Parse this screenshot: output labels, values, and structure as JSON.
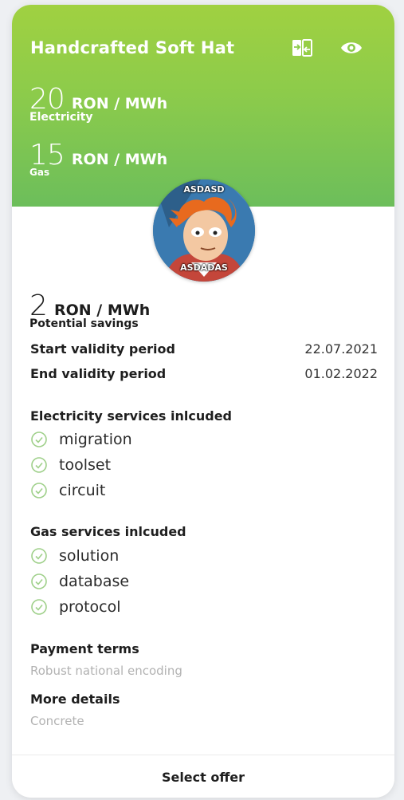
{
  "card": {
    "title": "Handcrafted Soft Hat",
    "colors": {
      "header_top": "#a0d141",
      "header_bottom": "#6cbe5b",
      "check": "#9fd08a"
    },
    "icons": {
      "compare": "compare-icon",
      "view": "eye-icon",
      "check": "check-circle-icon"
    },
    "electricity": {
      "value": "20",
      "unit": "RON / MWh",
      "label": "Electricity"
    },
    "gas": {
      "value": "15",
      "unit": "RON / MWh",
      "label": "Gas"
    },
    "avatar": {
      "caption_top": "ASDASD",
      "caption_bottom": "ASDADAS"
    },
    "savings": {
      "value": "2",
      "unit": "RON / MWh",
      "label": "Potential savings"
    },
    "validity": {
      "start_label": "Start validity period",
      "start_value": "22.07.2021",
      "end_label": "End validity period",
      "end_value": "01.02.2022"
    },
    "electricity_services": {
      "title": "Electricity services inlcuded",
      "items": [
        "migration",
        "toolset",
        "circuit"
      ]
    },
    "gas_services": {
      "title": "Gas services inlcuded",
      "items": [
        "solution",
        "database",
        "protocol"
      ]
    },
    "payment_terms": {
      "title": "Payment terms",
      "value": "Robust national encoding"
    },
    "more_details": {
      "title": "More details",
      "value": "Concrete"
    },
    "action": {
      "label": "Select offer"
    }
  }
}
